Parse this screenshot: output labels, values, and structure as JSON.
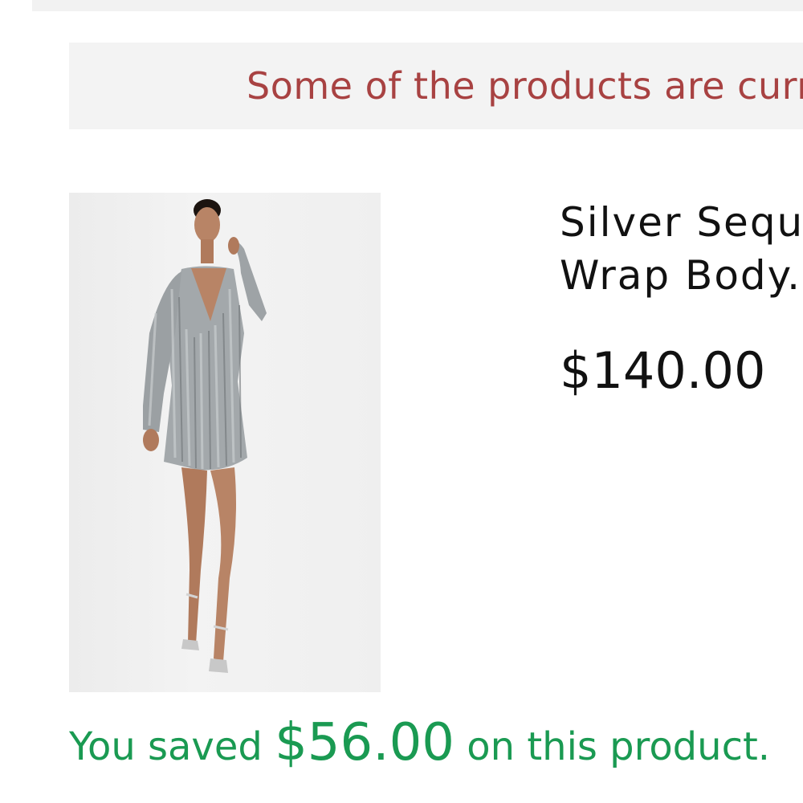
{
  "notice": {
    "text": "Some of the products are current"
  },
  "product": {
    "image_alt": "model-in-silver-sequin-dress",
    "title_line1": "Silver Sequi",
    "title_line2": "Wrap Body.",
    "price": "$140.00"
  },
  "savings": {
    "prefix": "You saved ",
    "amount": "$56.00",
    "suffix": " on this product."
  },
  "colors": {
    "notice_text": "#a84242",
    "savings_text": "#1a9a52",
    "banner_bg": "#f3f3f3"
  }
}
